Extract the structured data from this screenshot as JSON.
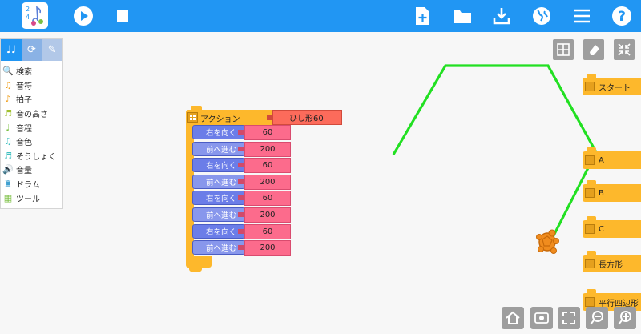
{
  "toolbar": {
    "logo_icon": "music-notes-logo",
    "left_buttons": [
      "run-icon",
      "stop-icon"
    ],
    "right_buttons": [
      "new-project-icon",
      "open-folder-icon",
      "save-download-icon",
      "planet-icon",
      "menu-icon",
      "help-icon"
    ],
    "accent": "#2196f3"
  },
  "palette": {
    "tabs": [
      "music-notes-icon",
      "flow-icon",
      "paintbrush-icon"
    ],
    "items": [
      {
        "label": "検索",
        "icon": "search-icon",
        "color": "#555555"
      },
      {
        "label": "音符",
        "icon": "note-icon",
        "color": "#f0a020"
      },
      {
        "label": "拍子",
        "icon": "meter-icon",
        "color": "#f0a020"
      },
      {
        "label": "音の高さ",
        "icon": "pitch-icon",
        "color": "#a0c030"
      },
      {
        "label": "音程",
        "icon": "interval-icon",
        "color": "#7bc043"
      },
      {
        "label": "音色",
        "icon": "tone-icon",
        "color": "#40c0c0"
      },
      {
        "label": "そうしょく",
        "icon": "ornament-icon",
        "color": "#40c0c0"
      },
      {
        "label": "音量",
        "icon": "volume-icon",
        "color": "#40a0d0"
      },
      {
        "label": "ドラム",
        "icon": "drum-icon",
        "color": "#40a0d0"
      },
      {
        "label": "ツール",
        "icon": "tool-icon",
        "color": "#7bc043"
      }
    ]
  },
  "blocks": {
    "action_label": "アクション",
    "action_name": "ひし形60",
    "commands": [
      {
        "label": "右を向く",
        "value": "60"
      },
      {
        "label": "前へ進む",
        "value": "200"
      },
      {
        "label": "右を向く",
        "value": "60"
      },
      {
        "label": "前へ進む",
        "value": "200"
      },
      {
        "label": "右を向く",
        "value": "60"
      },
      {
        "label": "前へ進む",
        "value": "200"
      },
      {
        "label": "右を向く",
        "value": "60"
      },
      {
        "label": "前へ進む",
        "value": "200"
      }
    ]
  },
  "start_blocks": [
    "スタート",
    "A",
    "B",
    "C",
    "長方形",
    "平行四辺形"
  ],
  "canvas_controls": [
    "grid-icon",
    "eraser-icon",
    "collapse-icon"
  ],
  "bottom_controls": [
    "home-icon",
    "eye-icon",
    "expand-icon",
    "zoom-out-icon",
    "zoom-in-icon"
  ],
  "turtle": {
    "icon": "turtle-icon",
    "color": "#f08c1e"
  },
  "trail_color": "#22e022"
}
